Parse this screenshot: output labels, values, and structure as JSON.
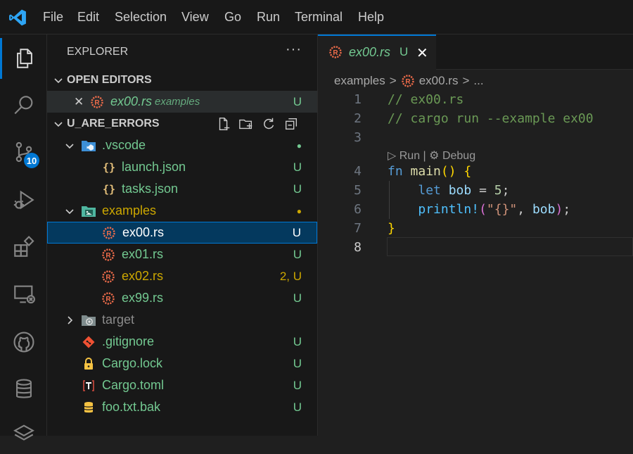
{
  "menubar": {
    "items": [
      "File",
      "Edit",
      "Selection",
      "View",
      "Go",
      "Run",
      "Terminal",
      "Help"
    ]
  },
  "activity": {
    "scm_badge": "10",
    "icons": [
      "explorer-icon",
      "search-icon",
      "source-control-icon",
      "run-debug-icon",
      "extensions-icon",
      "remote-explorer-icon",
      "github-icon",
      "database-icon",
      "layers-icon"
    ]
  },
  "explorer": {
    "title": "EXPLORER",
    "more": "···",
    "open_editors": {
      "label": "OPEN EDITORS",
      "items": [
        {
          "close": "✕",
          "name": "ex00.rs",
          "folder": "examples",
          "status": "U"
        }
      ]
    },
    "project": {
      "label": "U_ARE_ERRORS",
      "tree": [
        {
          "name": ".vscode",
          "status": "●",
          "kind": "folder-open"
        },
        {
          "name": "launch.json",
          "status": "U",
          "kind": "json"
        },
        {
          "name": "tasks.json",
          "status": "U",
          "kind": "json"
        },
        {
          "name": "examples",
          "status": "●",
          "kind": "folder-open"
        },
        {
          "name": "ex00.rs",
          "status": "U",
          "kind": "rust"
        },
        {
          "name": "ex01.rs",
          "status": "U",
          "kind": "rust"
        },
        {
          "name": "ex02.rs",
          "status": "2, U",
          "kind": "rust"
        },
        {
          "name": "ex99.rs",
          "status": "U",
          "kind": "rust"
        },
        {
          "name": "target",
          "status": "",
          "kind": "folder-closed"
        },
        {
          "name": ".gitignore",
          "status": "U",
          "kind": "git"
        },
        {
          "name": "Cargo.lock",
          "status": "U",
          "kind": "lock"
        },
        {
          "name": "Cargo.toml",
          "status": "U",
          "kind": "toml"
        },
        {
          "name": "foo.txt.bak",
          "status": "U",
          "kind": "bak"
        }
      ]
    }
  },
  "editor": {
    "tab": {
      "name": "ex00.rs",
      "status": "U",
      "close": "✕"
    },
    "breadcrumb": {
      "folder": "examples",
      "sep": ">",
      "file": "ex00.rs",
      "tail": "..."
    },
    "codelens": "▷ Run | ⚙ Debug",
    "line_numbers": [
      "1",
      "2",
      "3",
      "4",
      "5",
      "6",
      "7",
      "8"
    ],
    "code": {
      "l1": "// ex00.rs",
      "l2": "// cargo run --example ex00",
      "l4_kw": "fn",
      "l4_fn": "main",
      "l4_paren": "()",
      "l4_brace": "{",
      "l5_kw": "let",
      "l5_var": "bob",
      "l5_eq": " = ",
      "l5_num": "5",
      "l5_semi": ";",
      "l6_macro": "println!",
      "l6_open": "(",
      "l6_str": "\"{}\"",
      "l6_comma": ", ",
      "l6_var": "bob",
      "l6_close": ")",
      "l6_semi": ";",
      "l7_brace": "}"
    }
  }
}
